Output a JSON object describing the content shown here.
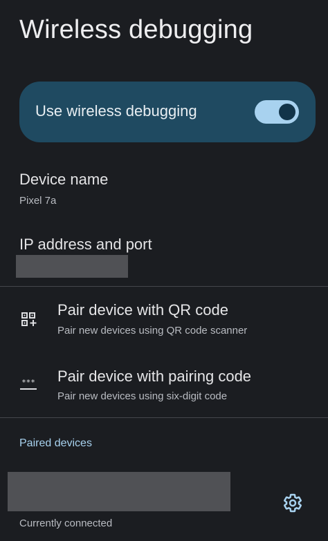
{
  "page": {
    "title": "Wireless debugging"
  },
  "main_switch": {
    "label": "Use wireless debugging",
    "checked": true,
    "accent_color": "#a8d2ef",
    "card_color": "#1f4a61"
  },
  "device_name": {
    "title": "Device name",
    "value": "Pixel 7a"
  },
  "ip_address": {
    "title": "IP address and port",
    "value_redacted": true
  },
  "pair_qr": {
    "title": "Pair device with QR code",
    "summary": "Pair new devices using QR code scanner",
    "icon": "qr-code-scanner-icon"
  },
  "pair_code": {
    "title": "Pair device with pairing code",
    "summary": "Pair new devices using six-digit code",
    "icon": "password-dialpad-icon"
  },
  "paired_devices": {
    "header": "Paired devices",
    "device": {
      "name_redacted": true,
      "status": "Currently connected",
      "action_icon": "gear-icon"
    }
  }
}
